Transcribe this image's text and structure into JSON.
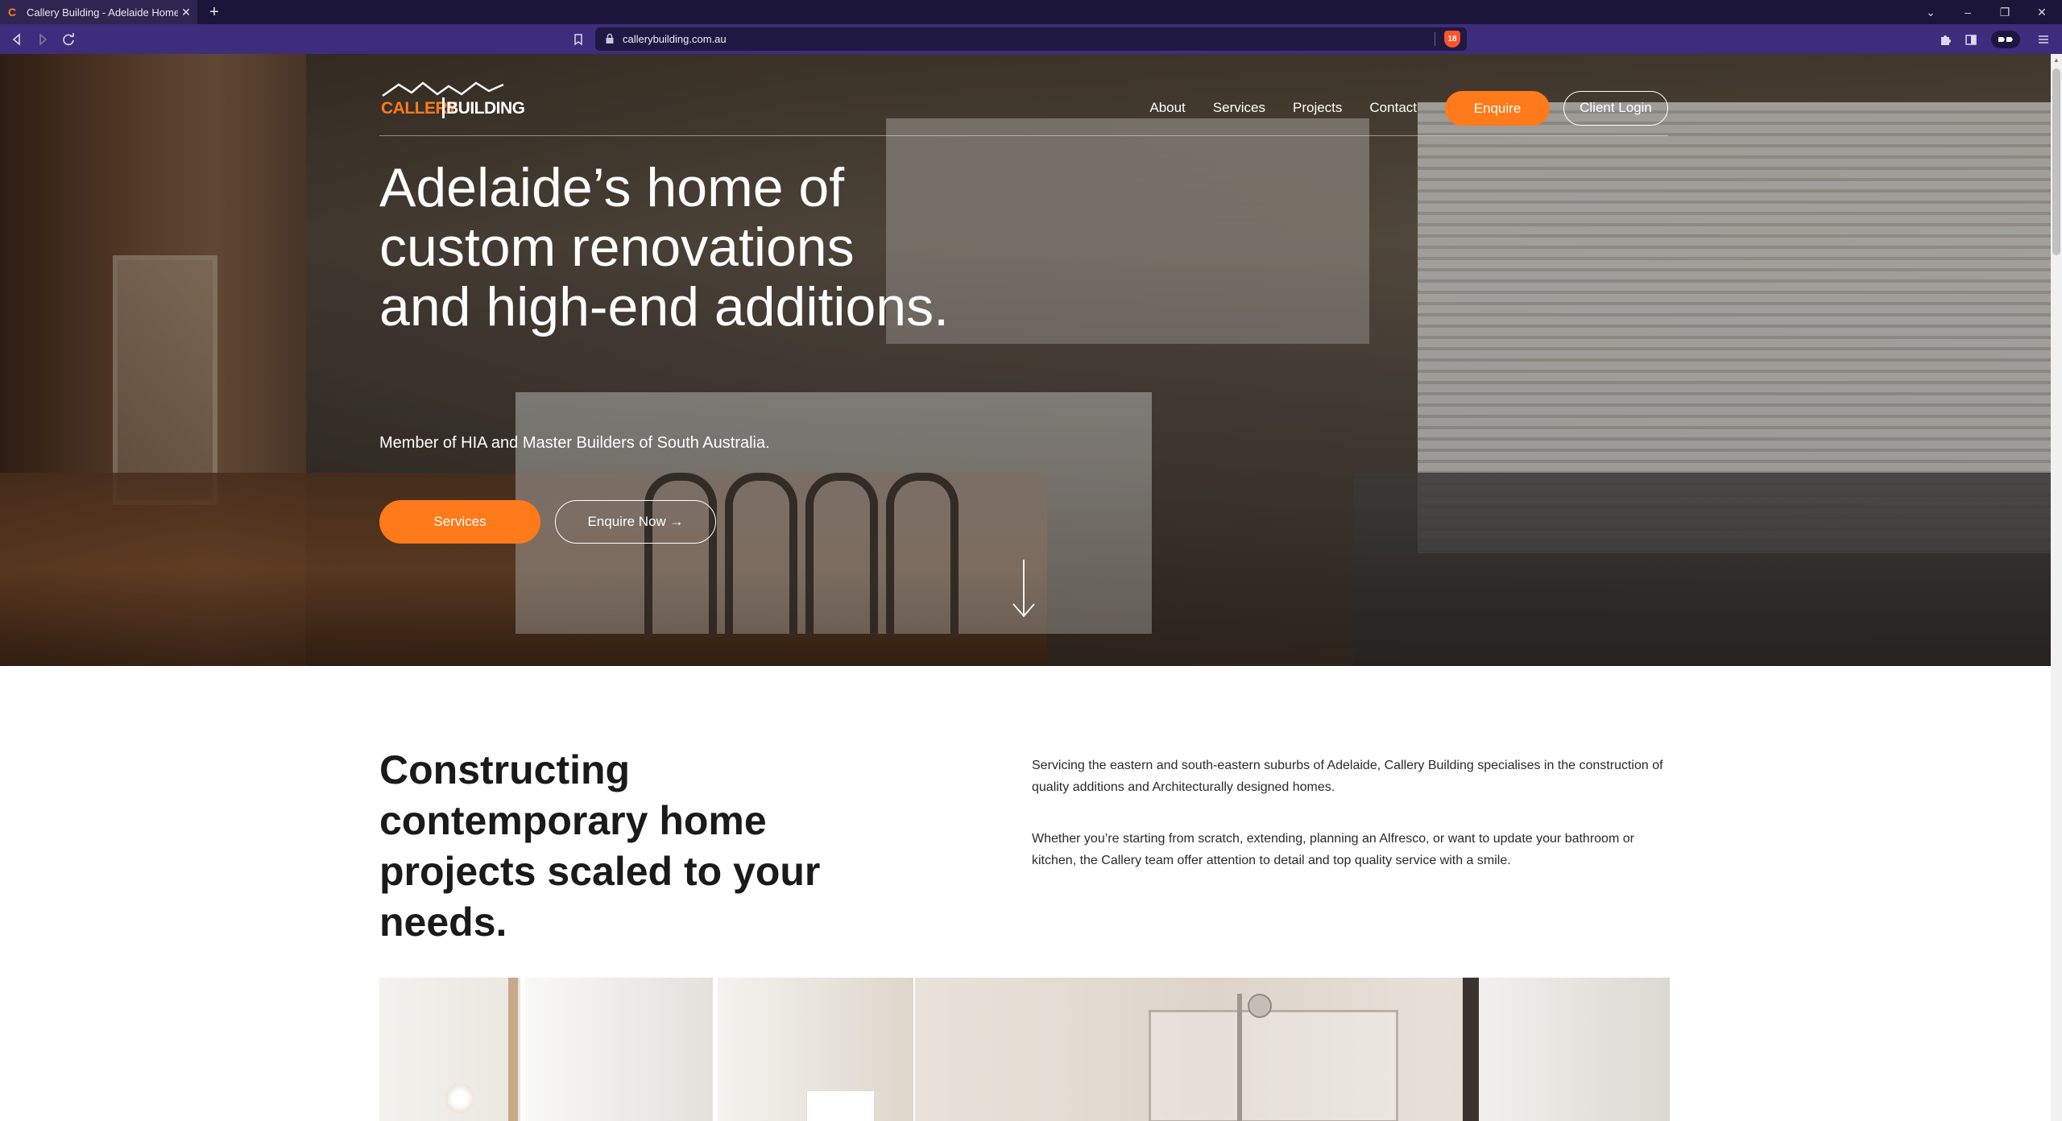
{
  "browser": {
    "tab_title": "Callery Building - Adelaide Home",
    "tab_favicon": "C",
    "tab_close": "✕",
    "new_tab": "+",
    "url": "callerybuilding.com.au",
    "window_controls": {
      "dropdown": "⌄",
      "minimize": "–",
      "restore": "❐",
      "close": "✕"
    },
    "icons": {
      "back": "back-icon",
      "forward": "forward-icon",
      "reload": "reload-icon",
      "bookmark": "bookmark-icon",
      "lock": "lock-icon",
      "brave_shield": "brave-shield-icon",
      "extensions": "puzzle-icon",
      "sidebar": "sidebar-icon",
      "wallet": "wallet-icon",
      "menu": "hamburger-icon"
    },
    "brave_shield_count": "18"
  },
  "site": {
    "logo": {
      "callery": "CALLERY",
      "building": "BUILDING"
    },
    "nav": {
      "about": "About",
      "services": "Services",
      "projects": "Projects",
      "contact": "Contact",
      "enquire": "Enquire",
      "client_login": "Client Login"
    },
    "hero": {
      "title": "Adelaide’s home of custom renovations and high-end additions.",
      "subtitle": "Member of HIA and Master Builders of South Australia.",
      "services_button": "Services",
      "enquire_now_button": "Enquire Now →",
      "scroll_icon": "arrow-down-icon"
    },
    "intro": {
      "title": "Constructing contemporary home projects scaled to your needs.",
      "paragraph_1": "Servicing the eastern and south-eastern suburbs of Adelaide, Callery Building specialises in the construction of quality additions and Architecturally designed homes.",
      "paragraph_2": "Whether you’re starting from scratch, extending, planning an Alfresco, or want to update your bathroom or kitchen, the Callery team offer attention to detail and top quality service with a smile."
    }
  },
  "colors": {
    "accent": "#ff7a1a",
    "chrome_tabbar": "#1b1539",
    "chrome_toolbar": "#3d2d7d",
    "heading_text": "#1a1a1a"
  }
}
